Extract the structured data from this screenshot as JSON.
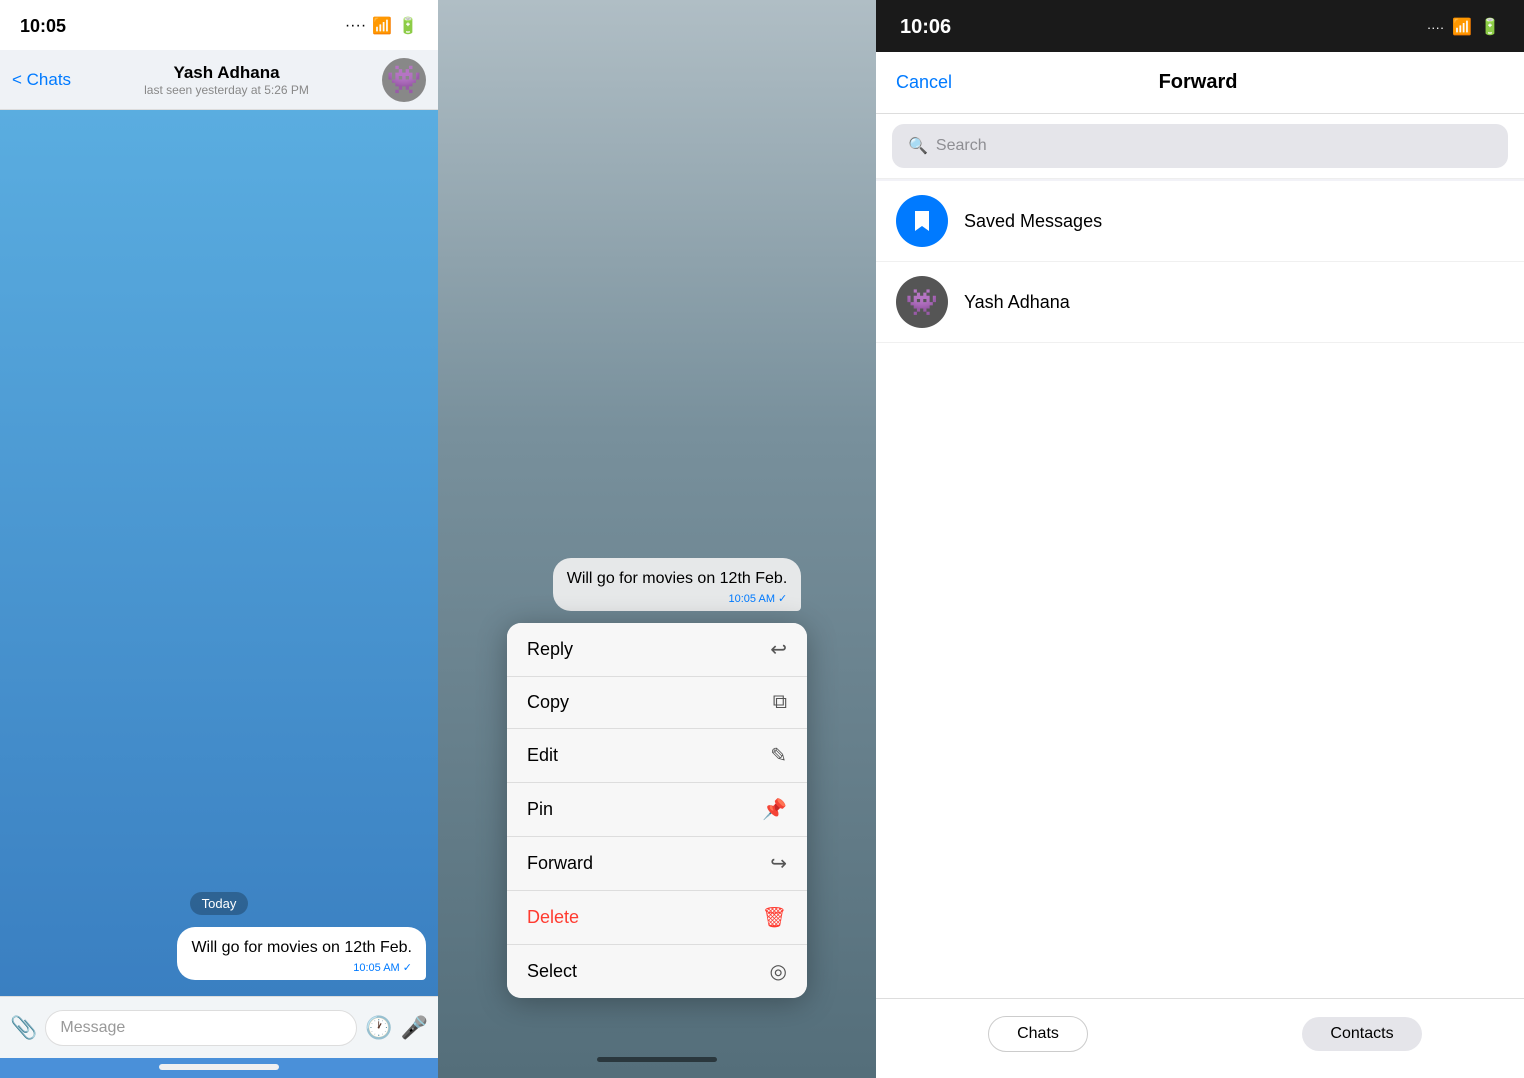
{
  "panel1": {
    "statusBar": {
      "time": "10:05",
      "signal": "····",
      "wifi": "▲",
      "battery": "▓"
    },
    "navBar": {
      "backLabel": "< Chats",
      "contactName": "Yash Adhana",
      "contactStatus": "last seen yesterday at 5:26 PM"
    },
    "dateBadge": "Today",
    "message": {
      "text": "Will go for movies on 12th Feb.",
      "time": "10:05 AM",
      "checkmark": "✓"
    },
    "inputPlaceholder": "Message"
  },
  "panel2": {
    "msgPreview": {
      "text": "Will go for movies on 12th Feb.",
      "time": "10:05 AM",
      "checkmark": "✓"
    },
    "contextMenu": [
      {
        "label": "Reply",
        "icon": "↩",
        "isDelete": false
      },
      {
        "label": "Copy",
        "icon": "⧉",
        "isDelete": false
      },
      {
        "label": "Edit",
        "icon": "✎",
        "isDelete": false
      },
      {
        "label": "Pin",
        "icon": "⚲",
        "isDelete": false
      },
      {
        "label": "Forward",
        "icon": "➦",
        "isDelete": false
      },
      {
        "label": "Delete",
        "icon": "🗑",
        "isDelete": true
      },
      {
        "label": "Select",
        "icon": "◎",
        "isDelete": false
      }
    ]
  },
  "panel3": {
    "statusBar": {
      "time": "10:06",
      "signal": "····",
      "wifi": "▲",
      "battery": "▓"
    },
    "navBar": {
      "cancelLabel": "Cancel",
      "title": "Forward"
    },
    "search": {
      "placeholder": "Search",
      "icon": "🔍"
    },
    "contacts": [
      {
        "name": "Saved Messages",
        "type": "saved",
        "icon": "🔖"
      },
      {
        "name": "Yash Adhana",
        "type": "yash",
        "icon": "👾"
      }
    ],
    "tabs": [
      {
        "label": "Chats",
        "active": true
      },
      {
        "label": "Contacts",
        "active": false
      }
    ]
  }
}
